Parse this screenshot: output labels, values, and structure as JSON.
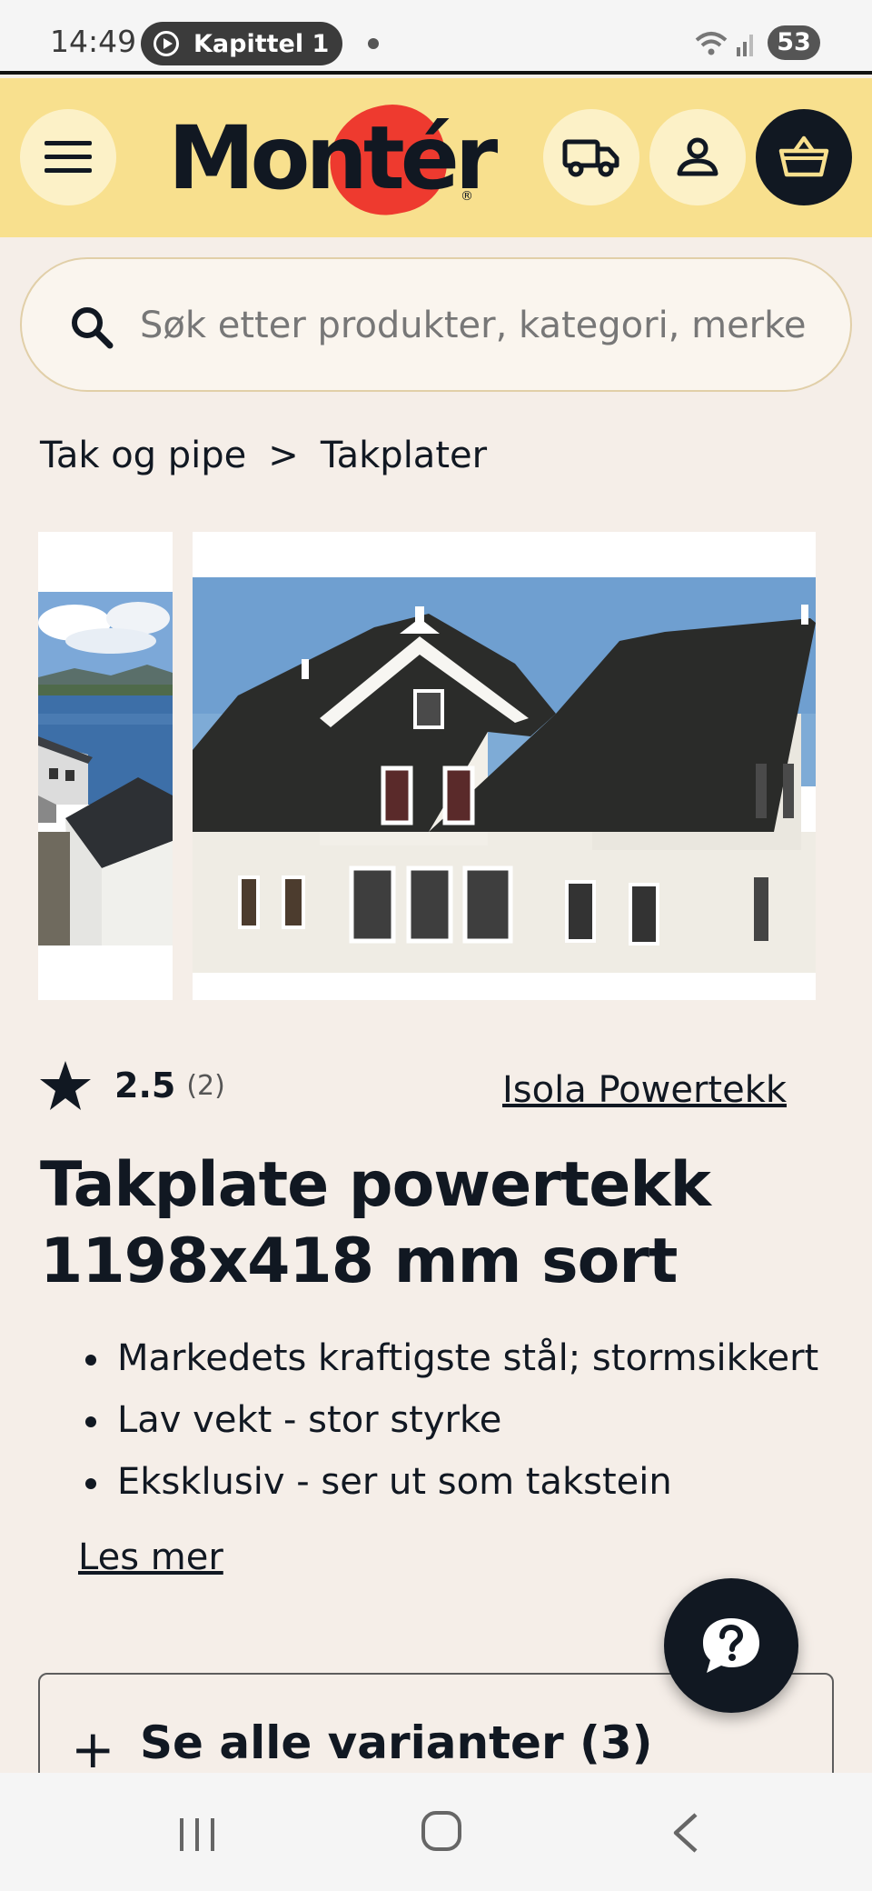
{
  "status_bar": {
    "time": "14:49",
    "media_label": "Kapittel 1 a",
    "battery": "53"
  },
  "header": {
    "logo_text": "Montér",
    "menu_icon": "hamburger-icon",
    "truck_icon": "truck-icon",
    "user_icon": "user-icon",
    "cart_icon": "basket-icon",
    "accent_color": "#f8e08e",
    "logo_blob_color": "#ee3a2f"
  },
  "search": {
    "placeholder": "Søk etter produkter, kategori, merke"
  },
  "breadcrumb": {
    "items": [
      "Tak og pipe",
      "Takplater"
    ],
    "separator": ">"
  },
  "product": {
    "rating": "2.5",
    "rating_count": "(2)",
    "brand": "Isola Powertekk",
    "title": "Takplate powertekk 1198x418 mm sort",
    "bullets": [
      "Markedets kraftigste stål; stormsikkert",
      "Lav vekt - stor styrke",
      "Eksklusiv - ser ut som takstein"
    ],
    "read_more": "Les mer",
    "variants_label": "Se alle varianter (3)"
  },
  "help": {
    "icon": "question-bubble-icon"
  },
  "navbar": {
    "recents_icon": "recents-icon",
    "home_icon": "home-icon",
    "back_icon": "back-icon"
  }
}
